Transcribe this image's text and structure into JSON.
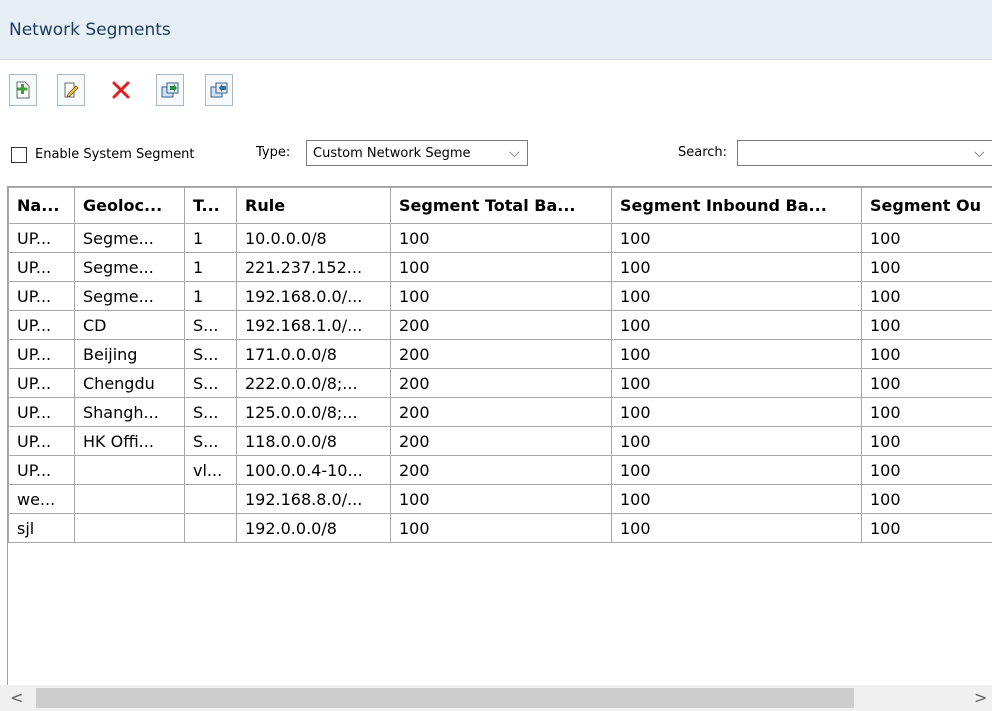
{
  "header": {
    "title": "Network Segments"
  },
  "toolbar": {
    "buttons": [
      {
        "name": "add-button",
        "icon": "add-document-icon"
      },
      {
        "name": "edit-button",
        "icon": "edit-pencil-icon"
      },
      {
        "name": "delete-button",
        "icon": "delete-x-icon"
      },
      {
        "name": "import-button",
        "icon": "import-icon"
      },
      {
        "name": "export-button",
        "icon": "export-icon"
      }
    ]
  },
  "filters": {
    "enable_system_segment": {
      "label": "Enable System Segment",
      "checked": false
    },
    "type": {
      "label": "Type:",
      "value": "Custom Network Segme"
    },
    "search": {
      "label": "Search:",
      "value": ""
    }
  },
  "table": {
    "columns": [
      "Na...",
      "Geoloc...",
      "T...",
      "Rule",
      "Segment Total Ba...",
      "Segment Inbound Ba...",
      "Segment Ou"
    ],
    "rows": [
      [
        "UP...",
        "Segme...",
        "1",
        "10.0.0.0/8",
        "100",
        "100",
        "100"
      ],
      [
        "UP...",
        "Segme...",
        "1",
        "221.237.152...",
        "100",
        "100",
        "100"
      ],
      [
        "UP...",
        "Segme...",
        "1",
        "192.168.0.0/...",
        "100",
        "100",
        "100"
      ],
      [
        "UP...",
        "CD",
        "S...",
        "192.168.1.0/...",
        "200",
        "100",
        "100"
      ],
      [
        "UP...",
        "Beijing",
        "S...",
        "171.0.0.0/8",
        "200",
        "100",
        "100"
      ],
      [
        "UP...",
        "Chengdu",
        "S...",
        "222.0.0.0/8;...",
        "200",
        "100",
        "100"
      ],
      [
        "UP...",
        "Shangh...",
        "S...",
        "125.0.0.0/8;...",
        "200",
        "100",
        "100"
      ],
      [
        "UP...",
        "HK Offi...",
        "S...",
        "118.0.0.0/8",
        "200",
        "100",
        "100"
      ],
      [
        "UP...",
        "",
        "vl...",
        "100.0.0.4-10...",
        "200",
        "100",
        "100"
      ],
      [
        "we...",
        "",
        "",
        "192.168.8.0/...",
        "100",
        "100",
        "100"
      ],
      [
        "sjl",
        "",
        "",
        "192.0.0.0/8",
        "100",
        "100",
        "100"
      ]
    ]
  },
  "scrollbar": {
    "left_arrow": "<",
    "right_arrow": ">"
  },
  "colors": {
    "header_bg": "#e6eef6",
    "title_text": "#1f3a5c",
    "delete_red": "#e02020",
    "add_green": "#3aa43a"
  }
}
